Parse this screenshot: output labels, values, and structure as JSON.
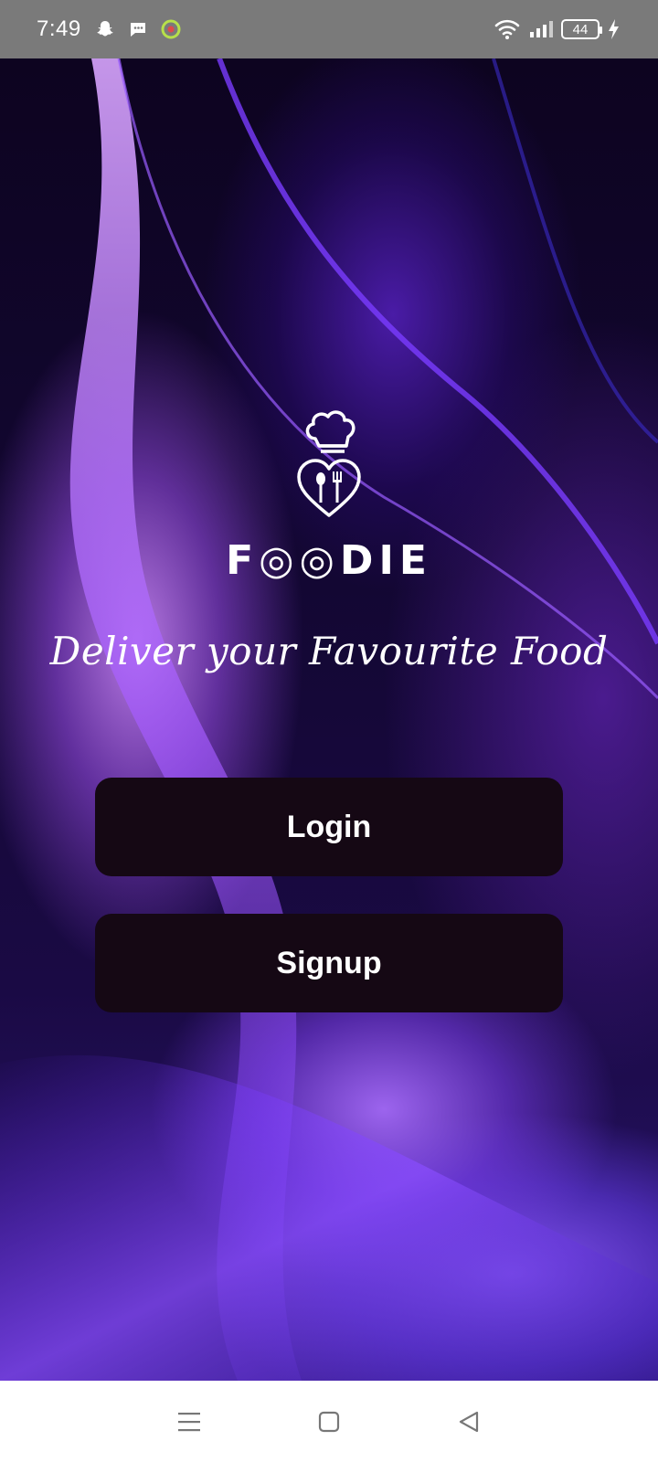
{
  "status_bar": {
    "time": "7:49",
    "battery_level": "44",
    "icons": [
      "snapchat-icon",
      "chat-bubble-icon",
      "target-app-icon",
      "wifi-icon",
      "signal-icon",
      "battery-icon",
      "charging-icon"
    ]
  },
  "app": {
    "brand_name": "F◎◎DIE",
    "tagline": "Deliver your Favourite Food",
    "logo_icon": "chef-hat-heart-cutlery-icon"
  },
  "actions": {
    "login_label": "Login",
    "signup_label": "Signup"
  },
  "nav_bar": {
    "icons": [
      "menu-icon",
      "home-icon",
      "back-icon"
    ]
  },
  "colors": {
    "button_bg": "#150814",
    "status_bar_bg": "#7a7a7a",
    "accent_purple": "#8a4dff"
  }
}
